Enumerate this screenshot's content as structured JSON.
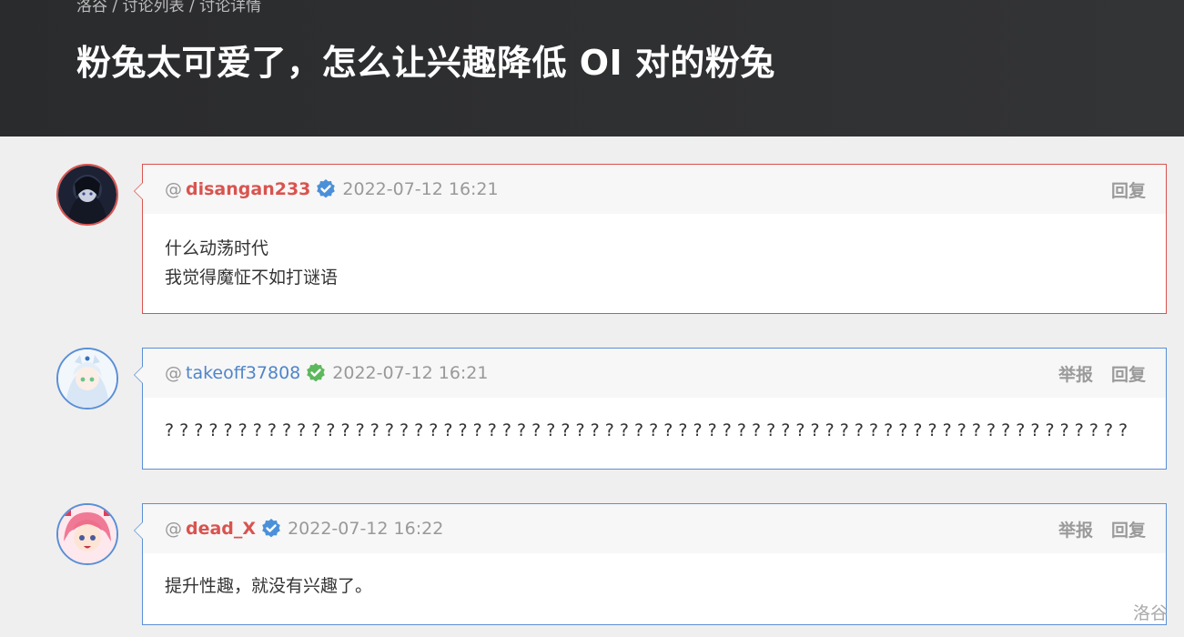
{
  "breadcrumb": "洛谷 / 讨论列表 / 讨论详情",
  "title": "粉兔太可爱了，怎么让兴趣降低 OI 对的粉兔",
  "posts": [
    {
      "at": "@",
      "username": "disangan233",
      "time": "2022-07-12 16:21",
      "report": "",
      "reply": "回复",
      "lines": [
        "什么动荡时代",
        "我觉得魔怔不如打谜语"
      ],
      "badge_color": "#4a90d9"
    },
    {
      "at": "@",
      "username": "takeoff37808",
      "time": "2022-07-12 16:21",
      "report": "举报",
      "reply": "回复",
      "lines": [
        "? ? ? ? ? ? ? ? ? ? ? ? ? ? ? ? ? ? ? ? ? ? ? ? ? ? ? ? ? ? ? ? ? ? ? ? ? ? ? ? ? ? ? ? ? ? ? ? ? ? ? ? ? ? ? ? ? ? ? ? ? ? ? ? ? ?"
      ],
      "badge_color": "#5cb85c"
    },
    {
      "at": "@",
      "username": "dead_X",
      "time": "2022-07-12 16:22",
      "report": "举报",
      "reply": "回复",
      "lines": [
        "提升性趣，就没有兴趣了。"
      ],
      "badge_color": "#4a90d9"
    }
  ],
  "watermark": "洛谷"
}
